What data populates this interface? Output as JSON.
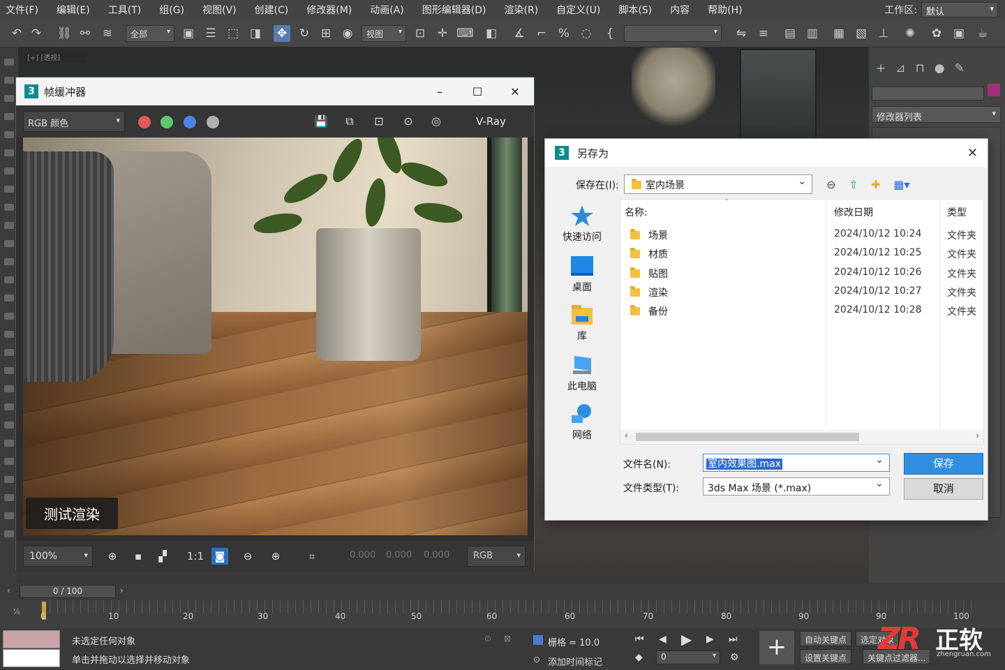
{
  "menubar": {
    "items": [
      "文件(F)",
      "编辑(E)",
      "工具(T)",
      "组(G)",
      "视图(V)",
      "创建(C)",
      "修改器(M)",
      "动画(A)",
      "图形编辑器(D)",
      "渲染(R)",
      "自定义(U)",
      "脚本(S)",
      "内容",
      "帮助(H)"
    ],
    "workspace_label": "工作区:",
    "workspace_value": "默认"
  },
  "toolbar": {
    "selection_filter": "全部",
    "ref_coord": "视图"
  },
  "command_panel": {
    "modifier_list": "修改器列表"
  },
  "framebuffer": {
    "app_badge": "3",
    "title": "帧缓冲器",
    "channel": "RGB 颜色",
    "renderer": "V-Ray",
    "render_label": "测试渲染",
    "zoom": "100%",
    "one_to_one": "1:1",
    "values": [
      "0.000",
      "0.000",
      "0.000"
    ],
    "display_mode": "RGB",
    "dot_colors": [
      "#e35a5a",
      "#5ec96a",
      "#4d86e8",
      "#b0b0b0"
    ]
  },
  "dialog": {
    "app_badge": "3",
    "title": "另存为",
    "save_in_label": "保存在(I):",
    "save_in_value": "室内场景",
    "places": [
      "快速访问",
      "桌面",
      "库",
      "此电脑",
      "网络"
    ],
    "columns": [
      "名称:",
      "修改日期",
      "类型"
    ],
    "files": [
      {
        "name": "场景",
        "date": "2024/10/12 10:24",
        "type": "文件夹"
      },
      {
        "name": "材质",
        "date": "2024/10/12 10:25",
        "type": "文件夹"
      },
      {
        "name": "贴图",
        "date": "2024/10/12 10:26",
        "type": "文件夹"
      },
      {
        "name": "渲染",
        "date": "2024/10/12 10:27",
        "type": "文件夹"
      },
      {
        "name": "备份",
        "date": "2024/10/12 10:28",
        "type": "文件夹"
      }
    ],
    "filename_label": "文件名(N):",
    "filename_value": "室内效果图.max",
    "filetype_label": "文件类型(T):",
    "filetype_value": "3ds Max 场景 (*.max)",
    "save_button": "保存",
    "cancel_button": "取消"
  },
  "timeline": {
    "slider": "0 / 100",
    "ticks": [
      "0",
      "10",
      "20",
      "30",
      "40",
      "50",
      "60",
      "60",
      "70",
      "80",
      "90",
      "90",
      "100"
    ]
  },
  "status": {
    "line1": "未选定任何对象",
    "line2": "单击并拖动以选择并移动对象",
    "grid": "栅格 = 10.0",
    "add_time_tag": "添加时间标记",
    "frame_value": "0",
    "auto_key": "自动关键点",
    "selected": "选定对象",
    "set_key": "设置关键点",
    "key_filters": "关键点过滤器..."
  },
  "logo": {
    "mark": "ZR",
    "name": "正软",
    "url": "zhengruan.com"
  }
}
